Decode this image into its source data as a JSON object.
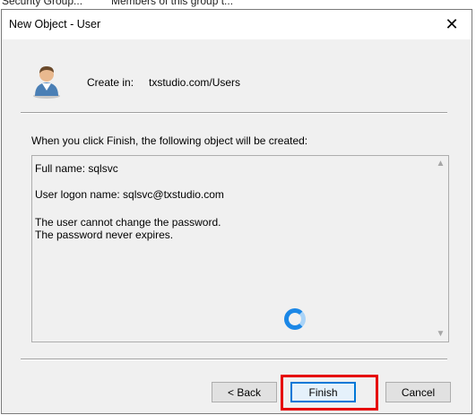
{
  "background": {
    "text_left": "Security Group...",
    "text_right": "Members of this group t..."
  },
  "dialog": {
    "title": "New Object - User",
    "close_glyph": "✕",
    "create_in_label": "Create in:",
    "create_in_path": "txstudio.com/Users",
    "info_text": "When you click Finish, the following object will be created:",
    "summary_lines": [
      "Full name: sqlsvc",
      "User logon name: sqlsvc@txstudio.com",
      "The user cannot change the password.",
      "The password never expires."
    ],
    "scroll_up_glyph": "▲",
    "scroll_down_glyph": "▼",
    "buttons": {
      "back": "< Back",
      "finish": "Finish",
      "cancel": "Cancel"
    }
  },
  "colors": {
    "highlight": "#e60000",
    "spinner": "#1b87e6",
    "focus_border": "#0078d7"
  },
  "icons": {
    "user": "user-icon",
    "close": "close-icon",
    "spinner": "loading-spinner-icon"
  }
}
